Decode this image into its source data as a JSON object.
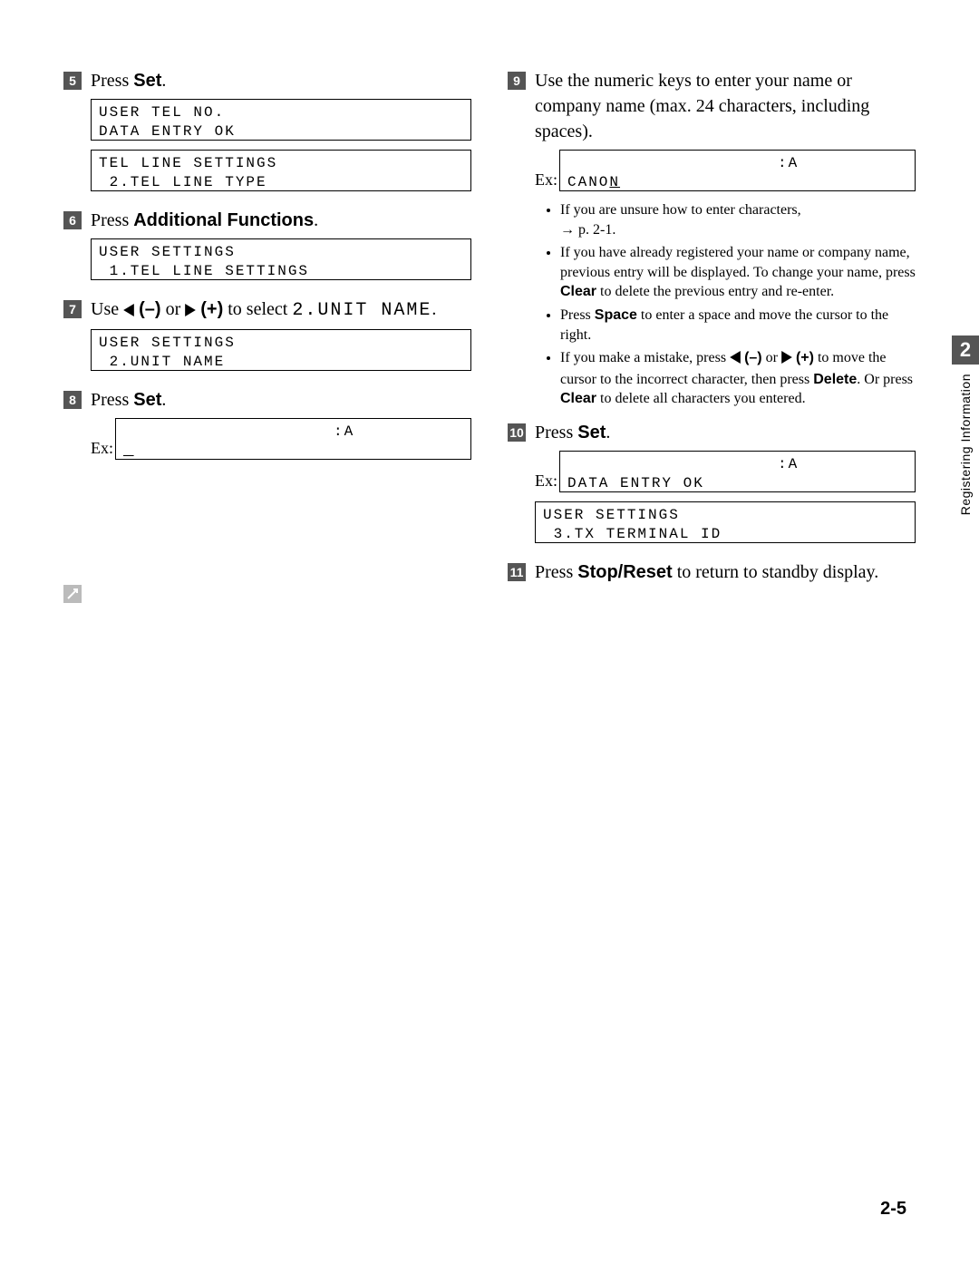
{
  "side_tab": {
    "number": "2",
    "label": "Registering Information"
  },
  "page_number": "2-5",
  "left": {
    "step5": {
      "num": "5",
      "prefix": "Press ",
      "button": "Set",
      "suffix": ".",
      "lcd1": "USER TEL NO.\nDATA ENTRY OK",
      "lcd2": "TEL LINE SETTINGS\n 2.TEL LINE TYPE"
    },
    "step6": {
      "num": "6",
      "prefix": "Press ",
      "button": "Additional Functions",
      "suffix": ".",
      "lcd1": "USER SETTINGS\n 1.TEL LINE SETTINGS"
    },
    "step7": {
      "num": "7",
      "pre": "Use ",
      "minus": "(–)",
      "or": " or ",
      "plus": "(+)",
      "post1": " to select ",
      "mono": "2.UNIT NAME",
      "post2": ".",
      "lcd1": "USER SETTINGS\n 2.UNIT NAME"
    },
    "step8": {
      "num": "8",
      "prefix": "Press ",
      "button": "Set",
      "suffix": ".",
      "ex_label": "Ex:",
      "lcd_top": "                    :A",
      "lcd_bottom": "_"
    }
  },
  "right": {
    "step9": {
      "num": "9",
      "text": "Use the numeric keys to enter your name or company name (max. 24 characters, including spaces).",
      "ex_label": "Ex:",
      "lcd_top": "                    :A",
      "lcd_bottom_pre": "CANO",
      "lcd_bottom_cur": "N",
      "b1a": "If you are unsure how to enter characters,",
      "b1b": "→ p. 2-1.",
      "b2a": "If you have already registered your name or company name, previous entry will be displayed. To change your name, press ",
      "b2_clear": "Clear",
      "b2b": " to delete the previous entry and re-enter.",
      "b3a": "Press ",
      "b3_space": "Space",
      "b3b": " to enter a space and move the cursor to the right.",
      "b4a": "If you make a mistake, press ",
      "b4_minus": "(–)",
      "b4_or": " or ",
      "b4_plus": "(+)",
      "b4b": " to move the cursor to the incorrect character, then press ",
      "b4_delete": "Delete",
      "b4c": ". Or press ",
      "b4_clear": "Clear",
      "b4d": " to delete all characters you entered."
    },
    "step10": {
      "num": "10",
      "prefix": "Press ",
      "button": "Set",
      "suffix": ".",
      "ex_label": "Ex:",
      "lcd_top": "                    :A",
      "lcd_bottom": "DATA ENTRY OK",
      "lcd2": "USER SETTINGS\n 3.TX TERMINAL ID"
    },
    "step11": {
      "num": "11",
      "prefix": "Press ",
      "button": "Stop/Reset",
      "suffix": " to return to standby display."
    }
  }
}
